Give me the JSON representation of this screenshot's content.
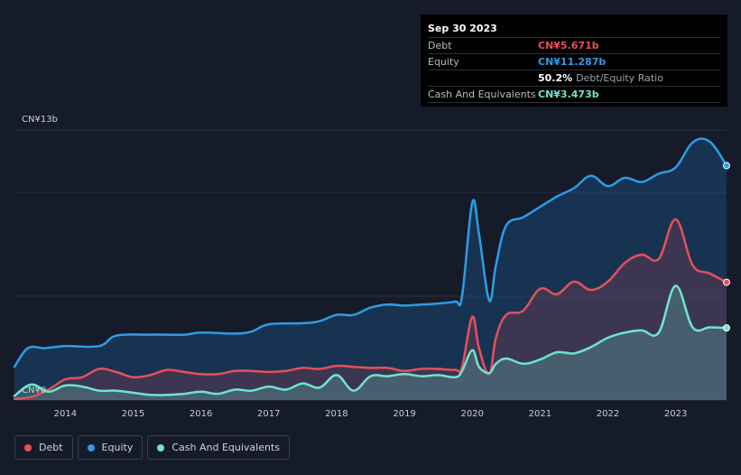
{
  "tooltip": {
    "date": "Sep 30 2023",
    "rows": [
      {
        "label": "Debt",
        "value": "CN¥5.671b",
        "color": "#e4505a"
      },
      {
        "label": "Equity",
        "value": "CN¥11.287b",
        "color": "#2e9ce6"
      },
      {
        "ratio_value": "50.2%",
        "ratio_label": "Debt/Equity Ratio"
      },
      {
        "label": "Cash And Equivalents",
        "value": "CN¥3.473b",
        "color": "#6fe4cf"
      }
    ]
  },
  "legend": [
    {
      "label": "Debt",
      "color": "#e4505a"
    },
    {
      "label": "Equity",
      "color": "#2e9ce6"
    },
    {
      "label": "Cash And Equivalents",
      "color": "#6fe4cf"
    }
  ],
  "chart_data": {
    "type": "area",
    "y_top_label": "CN¥13b",
    "y_bottom_label": "CN¥0",
    "ylim": [
      0,
      13
    ],
    "xlim": [
      2013.25,
      2023.75
    ],
    "x_ticks": [
      "2014",
      "2015",
      "2016",
      "2017",
      "2018",
      "2019",
      "2020",
      "2021",
      "2022",
      "2023"
    ],
    "series": [
      {
        "name": "Equity",
        "color": "#2e9ce6",
        "x": [
          2013.25,
          2013.45,
          2013.7,
          2014.0,
          2014.5,
          2014.75,
          2015.25,
          2015.75,
          2016.0,
          2016.5,
          2016.75,
          2017.0,
          2017.5,
          2017.75,
          2018.0,
          2018.25,
          2018.5,
          2018.75,
          2019.0,
          2019.25,
          2019.5,
          2019.75,
          2019.85,
          2020.0,
          2020.1,
          2020.25,
          2020.35,
          2020.5,
          2020.75,
          2021.0,
          2021.25,
          2021.5,
          2021.75,
          2022.0,
          2022.25,
          2022.5,
          2022.75,
          2023.0,
          2023.25,
          2023.5,
          2023.75
        ],
        "y": [
          1.6,
          2.5,
          2.5,
          2.6,
          2.6,
          3.1,
          3.15,
          3.15,
          3.25,
          3.2,
          3.3,
          3.65,
          3.7,
          3.8,
          4.1,
          4.1,
          4.45,
          4.6,
          4.55,
          4.6,
          4.65,
          4.75,
          5.0,
          9.5,
          8.0,
          4.8,
          6.5,
          8.4,
          8.8,
          9.3,
          9.8,
          10.2,
          10.8,
          10.3,
          10.7,
          10.5,
          10.9,
          11.2,
          12.4,
          12.45,
          11.287
        ]
      },
      {
        "name": "Debt",
        "color": "#e4505a",
        "x": [
          2013.25,
          2013.5,
          2013.75,
          2014.0,
          2014.25,
          2014.5,
          2014.75,
          2015.0,
          2015.25,
          2015.5,
          2015.75,
          2016.0,
          2016.25,
          2016.5,
          2016.75,
          2017.0,
          2017.25,
          2017.5,
          2017.75,
          2018.0,
          2018.25,
          2018.5,
          2018.75,
          2019.0,
          2019.25,
          2019.5,
          2019.75,
          2019.85,
          2020.0,
          2020.1,
          2020.25,
          2020.35,
          2020.5,
          2020.75,
          2021.0,
          2021.25,
          2021.5,
          2021.75,
          2022.0,
          2022.25,
          2022.5,
          2022.75,
          2023.0,
          2023.25,
          2023.5,
          2023.75
        ],
        "y": [
          0.05,
          0.15,
          0.5,
          1.0,
          1.1,
          1.5,
          1.35,
          1.1,
          1.2,
          1.45,
          1.35,
          1.25,
          1.25,
          1.4,
          1.4,
          1.35,
          1.4,
          1.55,
          1.5,
          1.65,
          1.6,
          1.55,
          1.55,
          1.4,
          1.5,
          1.5,
          1.45,
          1.6,
          4.0,
          2.5,
          1.25,
          3.0,
          4.1,
          4.3,
          5.35,
          5.1,
          5.7,
          5.3,
          5.7,
          6.6,
          7.0,
          6.8,
          8.7,
          6.5,
          6.1,
          5.671
        ]
      },
      {
        "name": "Cash And Equivalents",
        "color": "#6fe4cf",
        "x": [
          2013.25,
          2013.5,
          2013.75,
          2014.0,
          2014.25,
          2014.5,
          2014.75,
          2015.0,
          2015.25,
          2015.5,
          2015.75,
          2016.0,
          2016.25,
          2016.5,
          2016.75,
          2017.0,
          2017.25,
          2017.5,
          2017.75,
          2018.0,
          2018.25,
          2018.5,
          2018.75,
          2019.0,
          2019.25,
          2019.5,
          2019.75,
          2019.85,
          2020.0,
          2020.1,
          2020.25,
          2020.35,
          2020.5,
          2020.75,
          2021.0,
          2021.25,
          2021.5,
          2021.75,
          2022.0,
          2022.25,
          2022.5,
          2022.75,
          2023.0,
          2023.25,
          2023.5,
          2023.75
        ],
        "y": [
          0.2,
          0.75,
          0.4,
          0.7,
          0.65,
          0.45,
          0.45,
          0.35,
          0.25,
          0.25,
          0.3,
          0.4,
          0.3,
          0.5,
          0.45,
          0.65,
          0.5,
          0.8,
          0.6,
          1.2,
          0.45,
          1.15,
          1.15,
          1.25,
          1.15,
          1.2,
          1.1,
          1.4,
          2.4,
          1.6,
          1.3,
          1.75,
          2.0,
          1.75,
          1.95,
          2.3,
          2.25,
          2.55,
          3.0,
          3.25,
          3.35,
          3.25,
          5.5,
          3.5,
          3.5,
          3.473
        ]
      }
    ]
  }
}
